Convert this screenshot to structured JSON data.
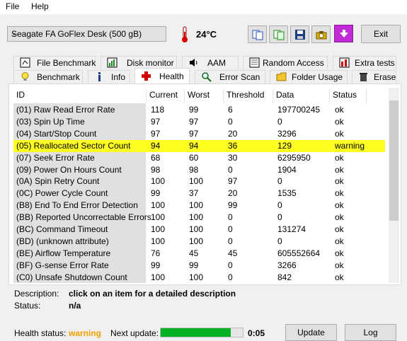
{
  "menu": {
    "file": "File",
    "help": "Help"
  },
  "drive": {
    "selected": "Seagate   FA GoFlex Desk (500 gB)",
    "temperature": "24°C"
  },
  "toolbar": {
    "exit_label": "Exit"
  },
  "tabs_top": [
    {
      "label": "File Benchmark"
    },
    {
      "label": "Disk monitor"
    },
    {
      "label": "AAM"
    },
    {
      "label": "Random Access"
    },
    {
      "label": "Extra tests"
    }
  ],
  "tabs_bottom": [
    {
      "label": "Benchmark"
    },
    {
      "label": "Info"
    },
    {
      "label": "Health"
    },
    {
      "label": "Error Scan"
    },
    {
      "label": "Folder Usage"
    },
    {
      "label": "Erase"
    }
  ],
  "table": {
    "columns": [
      "ID",
      "Current",
      "Worst",
      "Threshold",
      "Data",
      "Status"
    ],
    "rows": [
      {
        "id": "(01) Raw Read Error Rate",
        "current": "118",
        "worst": "99",
        "threshold": "6",
        "data": "197700245",
        "status": "ok"
      },
      {
        "id": "(03) Spin Up Time",
        "current": "97",
        "worst": "97",
        "threshold": "0",
        "data": "0",
        "status": "ok"
      },
      {
        "id": "(04) Start/Stop Count",
        "current": "97",
        "worst": "97",
        "threshold": "20",
        "data": "3296",
        "status": "ok"
      },
      {
        "id": "(05) Reallocated Sector Count",
        "current": "94",
        "worst": "94",
        "threshold": "36",
        "data": "129",
        "status": "warning"
      },
      {
        "id": "(07) Seek Error Rate",
        "current": "68",
        "worst": "60",
        "threshold": "30",
        "data": "6295950",
        "status": "ok"
      },
      {
        "id": "(09) Power On Hours Count",
        "current": "98",
        "worst": "98",
        "threshold": "0",
        "data": "1904",
        "status": "ok"
      },
      {
        "id": "(0A) Spin Retry Count",
        "current": "100",
        "worst": "100",
        "threshold": "97",
        "data": "0",
        "status": "ok"
      },
      {
        "id": "(0C) Power Cycle Count",
        "current": "99",
        "worst": "37",
        "threshold": "20",
        "data": "1535",
        "status": "ok"
      },
      {
        "id": "(B8) End To End Error Detection",
        "current": "100",
        "worst": "100",
        "threshold": "99",
        "data": "0",
        "status": "ok"
      },
      {
        "id": "(BB) Reported Uncorrectable Errors",
        "current": "100",
        "worst": "100",
        "threshold": "0",
        "data": "0",
        "status": "ok"
      },
      {
        "id": "(BC) Command Timeout",
        "current": "100",
        "worst": "100",
        "threshold": "0",
        "data": "131274",
        "status": "ok"
      },
      {
        "id": "(BD) (unknown attribute)",
        "current": "100",
        "worst": "100",
        "threshold": "0",
        "data": "0",
        "status": "ok"
      },
      {
        "id": "(BE) Airflow Temperature",
        "current": "76",
        "worst": "45",
        "threshold": "45",
        "data": "605552664",
        "status": "ok"
      },
      {
        "id": "(BF) G-sense Error Rate",
        "current": "99",
        "worst": "99",
        "threshold": "0",
        "data": "3266",
        "status": "ok"
      },
      {
        "id": "(C0) Unsafe Shutdown Count",
        "current": "100",
        "worst": "100",
        "threshold": "0",
        "data": "842",
        "status": "ok"
      }
    ]
  },
  "description": {
    "label": "Description:",
    "value": "click on an item for a detailed description"
  },
  "status": {
    "label": "Status:",
    "value": "n/a"
  },
  "footer": {
    "health_label": "Health status:",
    "health_value": "warning",
    "next_update_label": "Next update:",
    "next_update_time": "0:05",
    "progress": 0.85,
    "update_button": "Update",
    "log_button": "Log"
  },
  "colors": {
    "warning": "#f0a000",
    "highlight": "#ffff22",
    "progress": "#06b025"
  }
}
